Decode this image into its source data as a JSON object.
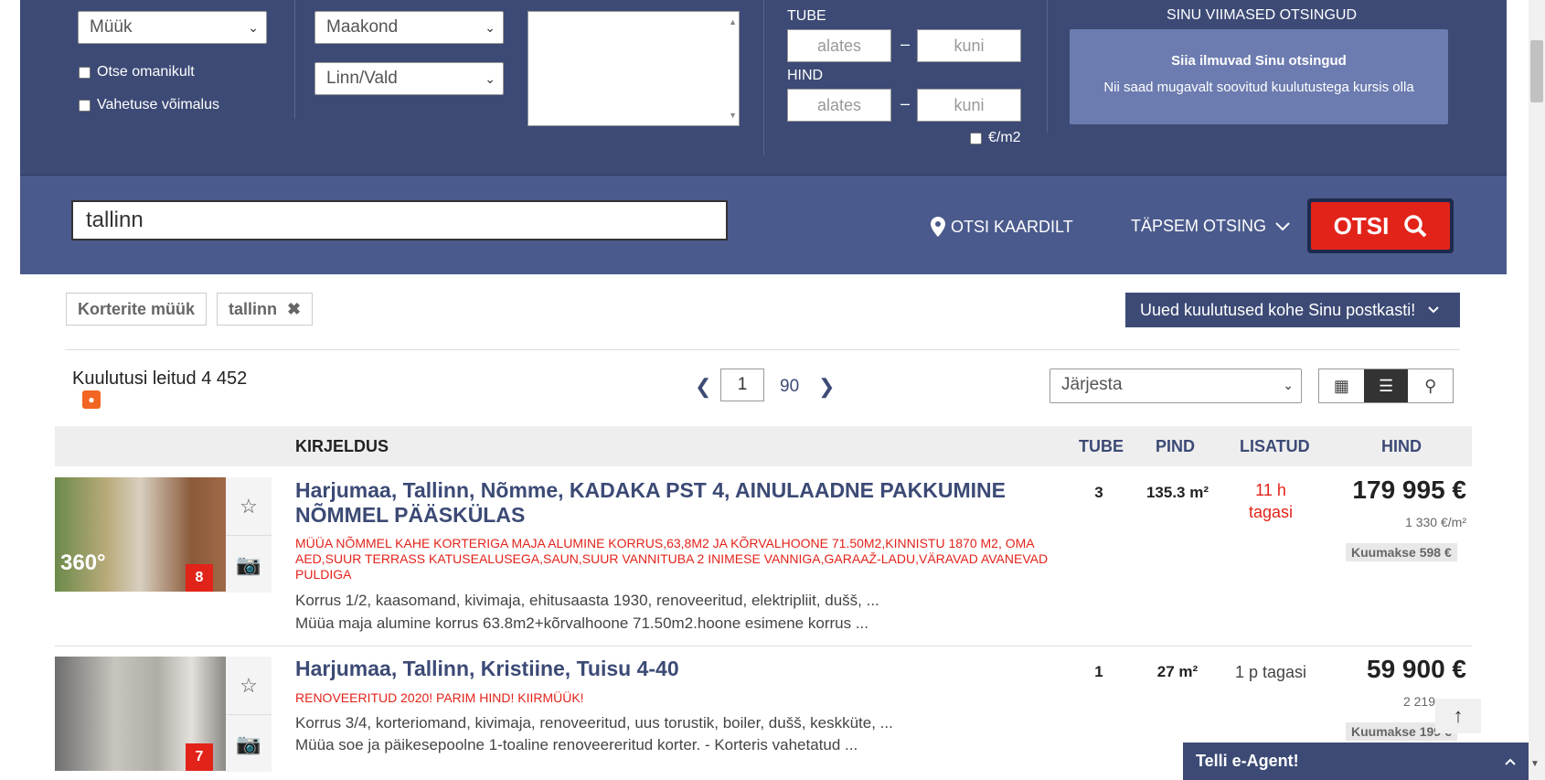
{
  "filters": {
    "deal_type": "Müük",
    "county": "Maakond",
    "city": "Linn/Vald",
    "direct_owner_label": "Otse omanikult",
    "exchange_label": "Vahetuse võimalus",
    "rooms_label": "TUBE",
    "price_label": "HIND",
    "from_placeholder": "alates",
    "to_placeholder": "kuni",
    "dash": "–",
    "per_m2_label": "€/m2"
  },
  "recent": {
    "title": "SINU VIIMASED OTSINGUD",
    "bold": "Siia ilmuvad Sinu otsingud",
    "sub": "Nii saad mugavalt soovitud kuulutustega kursis olla"
  },
  "search": {
    "value": "tallinn",
    "map_label": "OTSI KAARDILT",
    "advanced_label": "TÄPSEM OTSING",
    "submit_label": "OTSI"
  },
  "breadcrumbs": [
    "Korterite müük",
    "tallinn"
  ],
  "email_alert": "Uued kuulutused kohe Sinu postkasti!",
  "results": {
    "count_text": "Kuulutusi leitud 4 452",
    "page": "1",
    "total_pages": "90",
    "sort_placeholder": "Järjesta"
  },
  "table_headers": {
    "description": "KIRJELDUS",
    "rooms": "TUBE",
    "area": "PIND",
    "added": "LISATUD",
    "price": "HIND"
  },
  "listings": [
    {
      "title": "Harjumaa, Tallinn, Nõmme, KADAKA PST 4, AINULAADNE PAKKUMINE NÕMMEL PÄÄSKÜLAS",
      "tag": "MÜÜA NÕMMEL KAHE KORTERIGA MAJA ALUMINE KORRUS,63,8M2 JA KÕRVALHOONE 71.50M2,KINNISTU 1870 M2, OMA AED,SUUR TERRASS KATUSEALUSEGA,SAUN,SUUR VANNITUBA 2 INIMESE VANNIGA,GARAAŽ-LADU,VÄRAVAD AVANEVAD PULDIGA",
      "desc1": "Korrus 1/2, kaasomand, kivimaja, ehitusaasta 1930, renoveeritud, elektripliit, dušš, ...",
      "desc2": "Müüa maja alumine korrus 63.8m2+kõrvalhoone 71.50m2.hoone esimene korrus ...",
      "rooms": "3",
      "area": "135.3 m²",
      "added": "11 h tagasi",
      "price": "179 995 €",
      "price_per_m2": "1 330 €/m²",
      "monthly": "Kuumakse 598 €",
      "photo_count": "8",
      "pano_label": "360°"
    },
    {
      "title": "Harjumaa, Tallinn, Kristiine, Tuisu 4-40",
      "tag": "RENOVEERITUD 2020! PARIM HIND! KIIRMÜÜK!",
      "desc1": "Korrus 3/4, korteriomand, kivimaja, renoveeritud, uus torustik, boiler, dušš, keskküte, ...",
      "desc2": "Müüa soe ja päikesepoolne 1-toaline renoveereritud korter. - Korteris vahetatud ...",
      "rooms": "1",
      "area": "27 m²",
      "added": "1 p tagasi",
      "price": "59 900 €",
      "price_per_m2": "2 219",
      "monthly": "Kuumakse 199 €",
      "photo_count": "7"
    }
  ],
  "eagent_label": "Telli e-Agent!",
  "icons": {
    "rss": "rss-icon",
    "map_pin": "map-pin-icon",
    "search": "search-icon",
    "close": "close-icon",
    "star": "star-icon",
    "camera": "camera-icon",
    "chevron": "chevron-down-icon"
  },
  "colors": {
    "primary": "#3c4a75",
    "search_bar": "#4a5a8c",
    "accent": "#e2231a",
    "recent_box": "#6c7cb0"
  }
}
